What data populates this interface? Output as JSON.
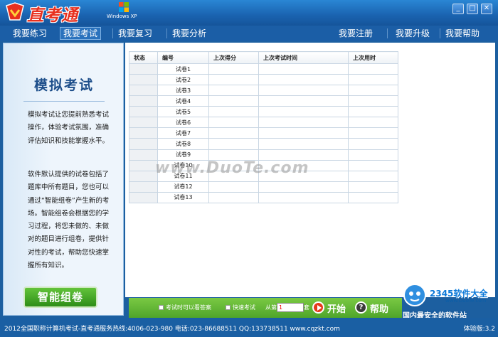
{
  "app": {
    "logo_text": "直考通",
    "os_badge": "Windows XP"
  },
  "window_controls": {
    "minimize": "_",
    "maximize": "□",
    "close": "✕"
  },
  "nav": {
    "left": [
      "我要练习",
      "我要考试",
      "我要复习",
      "我要分析"
    ],
    "right": [
      "我要注册",
      "我要升级",
      "我要帮助"
    ],
    "active": "我要考试"
  },
  "sidebar": {
    "title": "模拟考试",
    "paragraph1": "模拟考试让您提前熟悉考试操作，体验考试氛围，准确评估知识和技能掌握水平。",
    "paragraph2": "软件默认提供的试卷包括了题库中所有题目，您也可以通过“智能组卷”产生新的考场。智能组卷会根据您的学习过程，将您未做的、未做对的题目进行组卷，提供针对性的考试，帮助您快速掌握所有知识。",
    "smart_button": "智能组卷"
  },
  "table": {
    "headers": [
      "状态",
      "编号",
      "上次得分",
      "上次考试时间",
      "上次用时"
    ],
    "rows": [
      "试卷1",
      "试卷2",
      "试卷3",
      "试卷4",
      "试卷5",
      "试卷6",
      "试卷7",
      "试卷8",
      "试卷9",
      "试卷10",
      "试卷11",
      "试卷12",
      "试卷13"
    ]
  },
  "watermark": "www.DuoTe.com",
  "bottom": {
    "option1": "考试时可以看答案",
    "option2": "快速考试",
    "from_label": "从第",
    "from_value": "1",
    "to_label": "套",
    "start": "开始",
    "help": "帮助"
  },
  "badge": {
    "brand": "2345软件大全",
    "url": "www.DuoTe.com",
    "slogan": "国内最安全的软件站"
  },
  "status": {
    "text": "2012全国职称计算机考试-直考通服务热线:4006-023-980 电话:023-86688511 QQ:133738511 www.cqzkt.com",
    "version": "体验版:3.2"
  },
  "colors": {
    "accent_green": "#5cb030",
    "title_blue": "#1a63b0",
    "logo_red": "#e8301e"
  }
}
